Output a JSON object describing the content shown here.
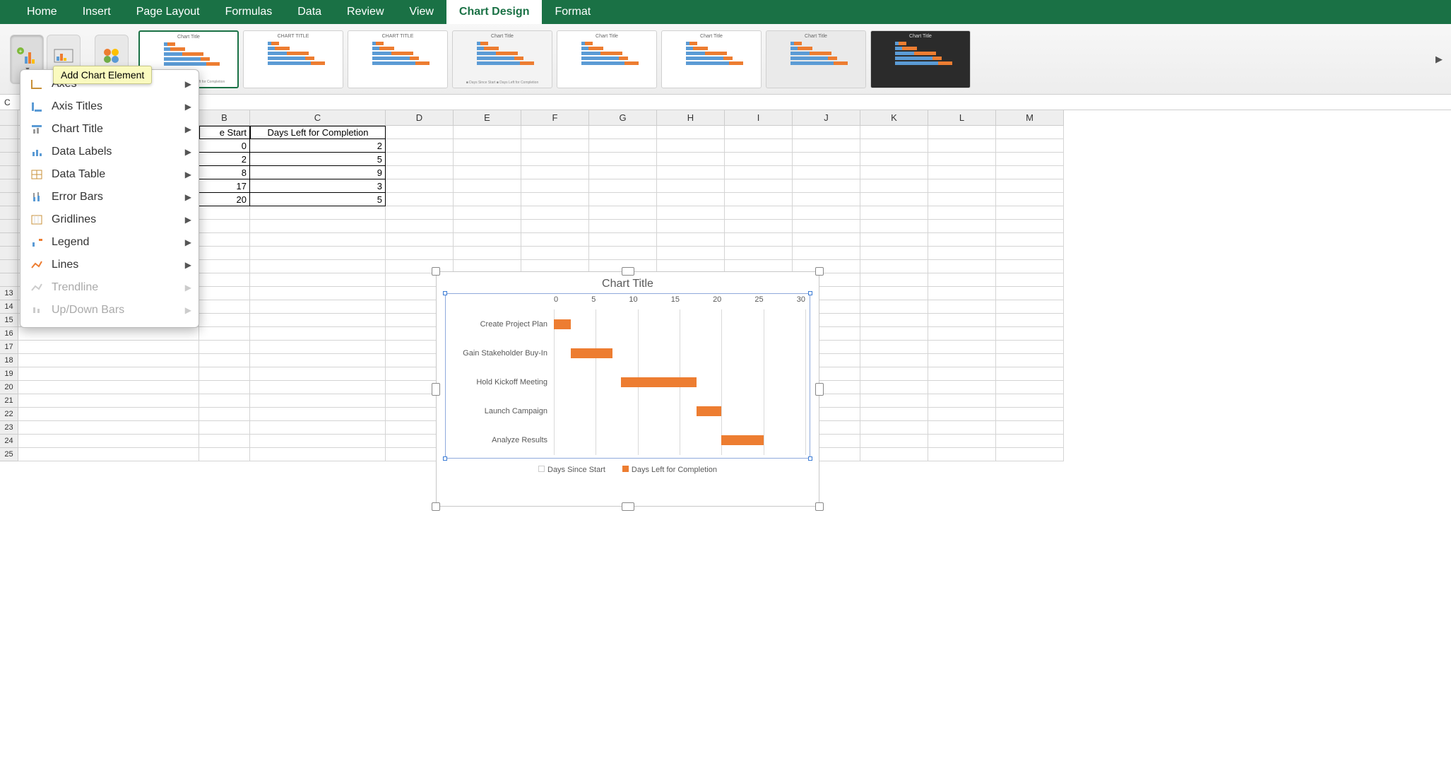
{
  "ribbon": {
    "tabs": [
      "Home",
      "Insert",
      "Page Layout",
      "Formulas",
      "Data",
      "Review",
      "View",
      "Chart Design",
      "Format"
    ],
    "active_tab": "Chart Design",
    "tooltip": "Add Chart Element",
    "menu_items": [
      {
        "label": "Axes",
        "disabled": false
      },
      {
        "label": "Axis Titles",
        "disabled": false
      },
      {
        "label": "Chart Title",
        "disabled": false
      },
      {
        "label": "Data Labels",
        "disabled": false
      },
      {
        "label": "Data Table",
        "disabled": false
      },
      {
        "label": "Error Bars",
        "disabled": false
      },
      {
        "label": "Gridlines",
        "disabled": false
      },
      {
        "label": "Legend",
        "disabled": false
      },
      {
        "label": "Lines",
        "disabled": false
      },
      {
        "label": "Trendline",
        "disabled": true
      },
      {
        "label": "Up/Down Bars",
        "disabled": true
      }
    ]
  },
  "formula_bar_label": "C",
  "columns": [
    "B",
    "C",
    "D",
    "E",
    "F",
    "G",
    "H",
    "I",
    "J",
    "K",
    "L",
    "M"
  ],
  "row_numbers": [
    "13",
    "14",
    "15",
    "16",
    "17",
    "18",
    "19",
    "20",
    "21",
    "22",
    "23",
    "24",
    "25"
  ],
  "table": {
    "headers": {
      "b_partial": "e Start",
      "c": "Days Left for Completion"
    },
    "rows": [
      {
        "b": "0",
        "c": "2"
      },
      {
        "b": "2",
        "c": "5"
      },
      {
        "b": "8",
        "c": "9"
      },
      {
        "b": "17",
        "c": "3"
      },
      {
        "b": "20",
        "c": "5"
      }
    ]
  },
  "chart_data": {
    "type": "bar",
    "title": "Chart Title",
    "categories": [
      "Create Project Plan",
      "Gain Stakeholder Buy-In",
      "Hold Kickoff Meeting",
      "Launch Campaign",
      "Analyze Results"
    ],
    "series": [
      {
        "name": "Days Since Start",
        "values": [
          0,
          2,
          8,
          17,
          20
        ]
      },
      {
        "name": "Days Left for Completion",
        "values": [
          2,
          5,
          9,
          3,
          5
        ]
      }
    ],
    "x_ticks": [
      "0",
      "5",
      "10",
      "15",
      "20",
      "25",
      "30"
    ],
    "xlim": [
      0,
      30
    ]
  }
}
